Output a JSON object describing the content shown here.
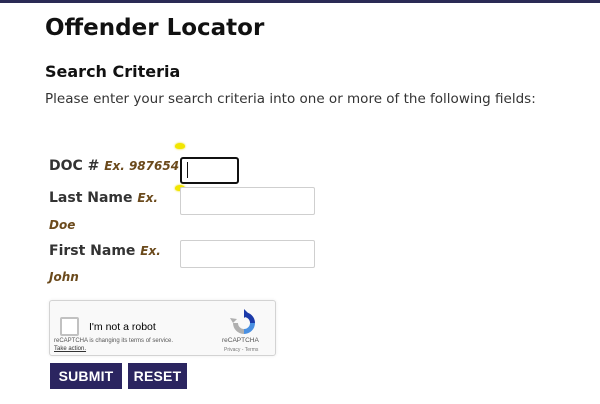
{
  "page": {
    "title": "Offender Locator",
    "subtitle": "Search Criteria",
    "instructions": "Please enter your search criteria into one or more of the following fields:"
  },
  "form": {
    "doc": {
      "label": "DOC #",
      "example": "Ex. 987654",
      "value": ""
    },
    "last_name": {
      "label": "Last Name",
      "example_prefix": "Ex.",
      "example_value": "Doe",
      "value": ""
    },
    "first_name": {
      "label": "First Name",
      "example_prefix": "Ex.",
      "example_value": "John",
      "value": ""
    }
  },
  "captcha": {
    "label": "I'm not a robot",
    "note": "reCAPTCHA is changing its terms of service.",
    "link": "Take action.",
    "brand": "reCAPTCHA",
    "terms": "Privacy - Terms",
    "checked": false
  },
  "buttons": {
    "submit": "SUBMIT",
    "reset": "RESET"
  },
  "colors": {
    "button_bg": "#2b2560",
    "example_text": "#6b4a1c",
    "top_bar": "#2a2a55"
  },
  "icons": {
    "captcha_logo": "recaptcha-logo-icon"
  }
}
